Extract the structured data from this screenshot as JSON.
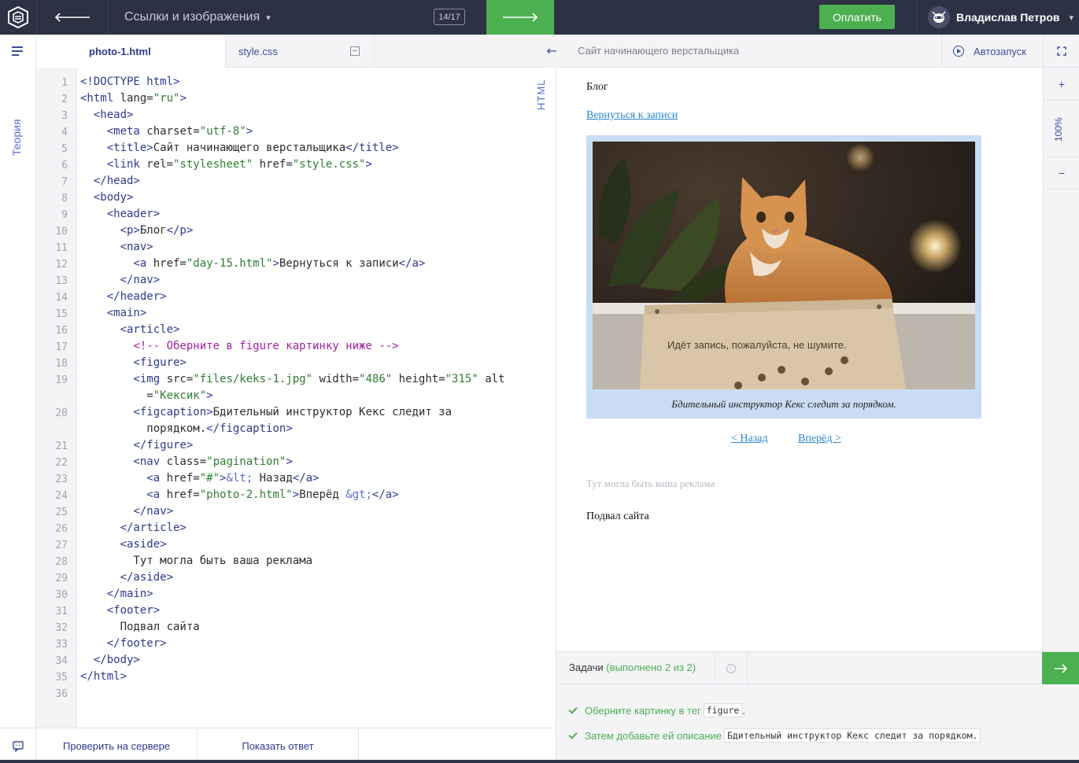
{
  "topbar": {
    "section_title": "Ссылки и изображения",
    "counter": "14/17",
    "pay_label": "Оплатить",
    "user_name": "Владислав Петров"
  },
  "rail": {
    "theory_label": "Теория"
  },
  "editor": {
    "tabs": [
      {
        "label": "photo-1.html",
        "active": true
      },
      {
        "label": "style.css",
        "active": false
      }
    ],
    "language_label": "HTML",
    "line_numbers": [
      "1",
      "2",
      "3",
      "4",
      "5",
      "6",
      "7",
      "8",
      "9",
      "10",
      "11",
      "12",
      "13",
      "14",
      "15",
      "16",
      "17",
      "18",
      "19",
      "",
      "20",
      "",
      "21",
      "22",
      "23",
      "24",
      "25",
      "26",
      "27",
      "28",
      "29",
      "30",
      "31",
      "32",
      "33",
      "34",
      "35",
      "36"
    ]
  },
  "bottombar": {
    "check_label": "Проверить на сервере",
    "answer_label": "Показать ответ"
  },
  "preview": {
    "title": "Сайт начинающего верстальщика",
    "autorun_label": "Автозапуск",
    "zoom": "100%",
    "zoom_in": "+",
    "zoom_out": "−",
    "page": {
      "blog": "Блог",
      "back_link": "Вернуться к записи",
      "photo_sign_text": "Идёт запись, пожалуйста, не шумите.",
      "caption": "Бдительный инструктор Кекс следит за порядком.",
      "prev": "< Назад",
      "next": "Вперёд >",
      "aside": "Тут могла быть ваша реклама",
      "footer": "Подвал сайта"
    }
  },
  "tasks": {
    "header": "Задачи",
    "progress": "(выполнено 2 из 2)",
    "items": [
      {
        "text": "Оберните картинку в тег",
        "code": "figure",
        "suffix": "."
      },
      {
        "text": "Затем добавьте ей описание",
        "code": "Бдительный инструктор Кекс следит за порядком.",
        "suffix": ""
      }
    ]
  },
  "colors": {
    "topbar_bg": "#2d3144",
    "accent_green": "#4caf50",
    "link_blue": "#2a85d0",
    "figure_bg": "#c9dcf3"
  }
}
